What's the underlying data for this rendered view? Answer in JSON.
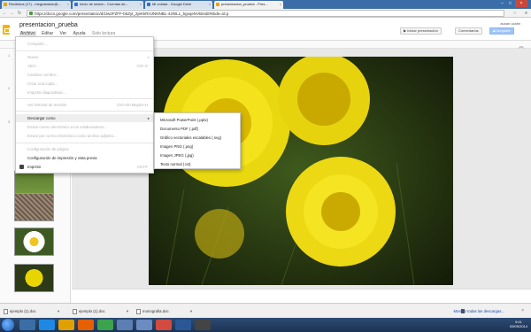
{
  "browser": {
    "tabs": [
      {
        "label": "Recibidos (17) - megustatom@...",
        "active": false
      },
      {
        "label": "Inicio de sesión - Cuentas de...",
        "active": false
      },
      {
        "label": "Mi unidad - Google Drive",
        "active": false
      },
      {
        "label": "presentacion_prueba - Pres...",
        "active": true
      }
    ],
    "url": "https://docs.google.com/presentation/d/1lw2FZFF-b5Zyt_2jeKkRHJNNNBL-42WLL_bgvqeNVB/edit#slide=id.p"
  },
  "docs": {
    "title": "presentacion_prueba",
    "menus": [
      "Archivo",
      "Editar",
      "Ver",
      "Ayuda",
      "Solo lectura"
    ],
    "user": "aucan ucalm",
    "buttons": {
      "present": "Iniciar presentación",
      "comments": "Comentarios",
      "share": "Compartir"
    }
  },
  "archivo_menu": {
    "items": [
      {
        "label": "Compartir...",
        "disabled": true,
        "shortcut": ""
      },
      {
        "label": "Nuevo",
        "disabled": true,
        "shortcut": ""
      },
      {
        "label": "Abrir...",
        "disabled": true,
        "shortcut": "Ctrl+O"
      },
      {
        "label": "Cambiar nombre...",
        "disabled": true,
        "shortcut": ""
      },
      {
        "label": "Crear una copia...",
        "disabled": true,
        "shortcut": ""
      },
      {
        "label": "Importar diapositivas...",
        "disabled": true,
        "shortcut": ""
      },
      {
        "label": "Ver historial de revisión",
        "disabled": true,
        "shortcut": "Ctrl+Alt+Mayús+H"
      },
      {
        "label": "Descargar como",
        "disabled": false,
        "shortcut": ""
      },
      {
        "label": "Enviar correo electrónico a los colaboradores...",
        "disabled": true,
        "shortcut": ""
      },
      {
        "label": "Enviar por correo electrónico como archivo adjunto...",
        "disabled": true,
        "shortcut": ""
      },
      {
        "label": "Configuración de página",
        "disabled": true,
        "shortcut": ""
      },
      {
        "label": "Configuración de impresión y vista previa",
        "disabled": false,
        "shortcut": ""
      },
      {
        "label": "Imprimir",
        "disabled": false,
        "shortcut": "Ctrl+P"
      }
    ]
  },
  "descargar_menu": {
    "items": [
      "Microsoft PowerPoint (.pptx)",
      "Documento PDF (.pdf)",
      "Gráfico vectoriales escalables (.svg)",
      "Imagen PNG (.png)",
      "Imagen JPEG (.jpg)",
      "Texto normal (.txt)"
    ]
  },
  "downloads": {
    "files": [
      "ejemplo (1).doc",
      "ejemplo (1).doc",
      "monografia.doc"
    ],
    "show_all": "Mostrar todas las descargas..."
  },
  "taskbar": {
    "time": "9:41",
    "date": "09/09/2014"
  }
}
